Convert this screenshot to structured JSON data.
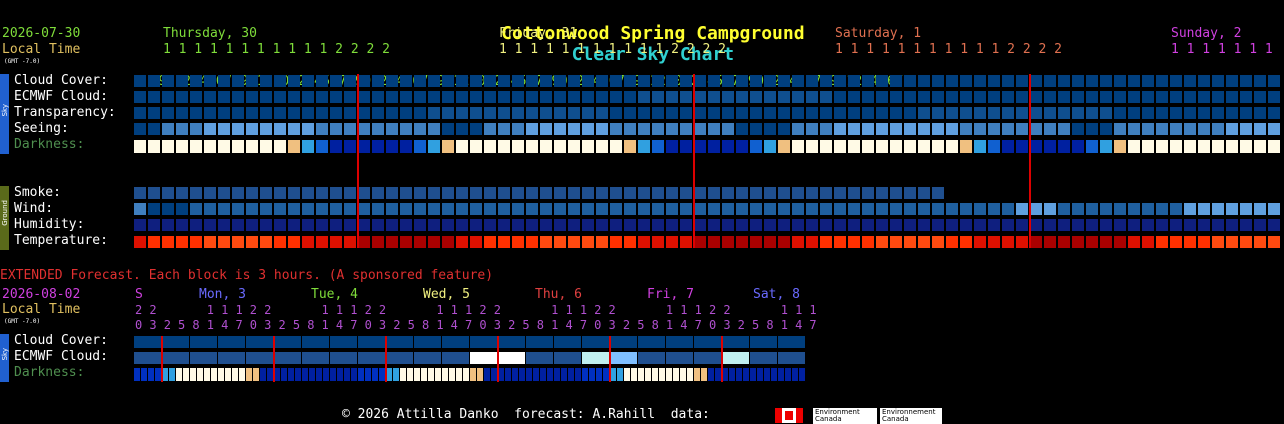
{
  "title": {
    "site": "Cottonwood Spring Campground",
    "chart": "Clear Sky Chart"
  },
  "main": {
    "date": "2026-07-30",
    "local_time": "Local Time",
    "gmt": "(GMT -7.0)",
    "days": [
      {
        "label": "Thursday, 30",
        "color": "#7fdd3a"
      },
      {
        "label": "Friday, 31",
        "color": "#f0f080"
      },
      {
        "label": "Saturday, 1",
        "color": "#e07050"
      },
      {
        "label": "Sunday, 2",
        "color": "#d040e0"
      }
    ],
    "hours_tens": "1 1 1 1 1 1 1 1 1 1 1 2 2 2 2",
    "hours_tens_short": "1 1 1 1 1 1 1",
    "hours_units": "89012345678901230123456789012345678901230123456789012345678901230123456789012345678901234567",
    "sky_labels": [
      "Cloud Cover:",
      "ECMWF Cloud:",
      "Transparency:",
      "Seeing:",
      "Darkness:"
    ],
    "ground_labels": [
      "Smoke:",
      "Wind:",
      "Humidity:",
      "Temperature:"
    ],
    "sky_tab": "Sky",
    "ground_tab": "Ground"
  },
  "extended": {
    "banner": "EXTENDED Forecast. Each block is 3 hours. (A sponsored feature)",
    "date": "2026-08-02",
    "local_time": "Local Time",
    "gmt": "(GMT -7.0)",
    "days": [
      {
        "label": "S",
        "color": "#d040e0"
      },
      {
        "label": "Mon, 3",
        "color": "#6a6aff"
      },
      {
        "label": "Tue, 4",
        "color": "#7fdd3a"
      },
      {
        "label": "Wed, 5",
        "color": "#f0f080"
      },
      {
        "label": "Thu, 6",
        "color": "#e04040"
      },
      {
        "label": "Fri, 7",
        "color": "#d040e0"
      },
      {
        "label": "Sat, 8",
        "color": "#6a6aff"
      }
    ],
    "hours_row1": "2 2       1 1 1 2 2       1 1 1 2 2       1 1 1 2 2       1 1 1 2 2       1 1 1 2 2       1 1 1",
    "hours_row2": "0 3 2 5 8 1 4 7 0 3 2 5 8 1 4 7 0 3 2 5 8 1 4 7 0 3 2 5 8 1 4 7 0 3 2 5 8 1 4 7 0 3 2 5 8 1 4 7",
    "sky_labels": [
      "Cloud Cover:",
      "ECMWF Cloud:",
      "Darkness:"
    ],
    "sky_tab": "Sky"
  },
  "footer": {
    "text": "© 2026 Attilla Danko  forecast: A.Rahill  data:",
    "env1": "Environment Canada",
    "env2": "Environnement Canada"
  },
  "colors": {
    "title_site": "#ffff30",
    "title_chart": "#30d0d0",
    "date": "#7fdd3a",
    "local_time": "#e0c060",
    "banner": "#e03030",
    "cloud_clear": "#003f7f",
    "midnight_line": "#dd0000"
  }
}
